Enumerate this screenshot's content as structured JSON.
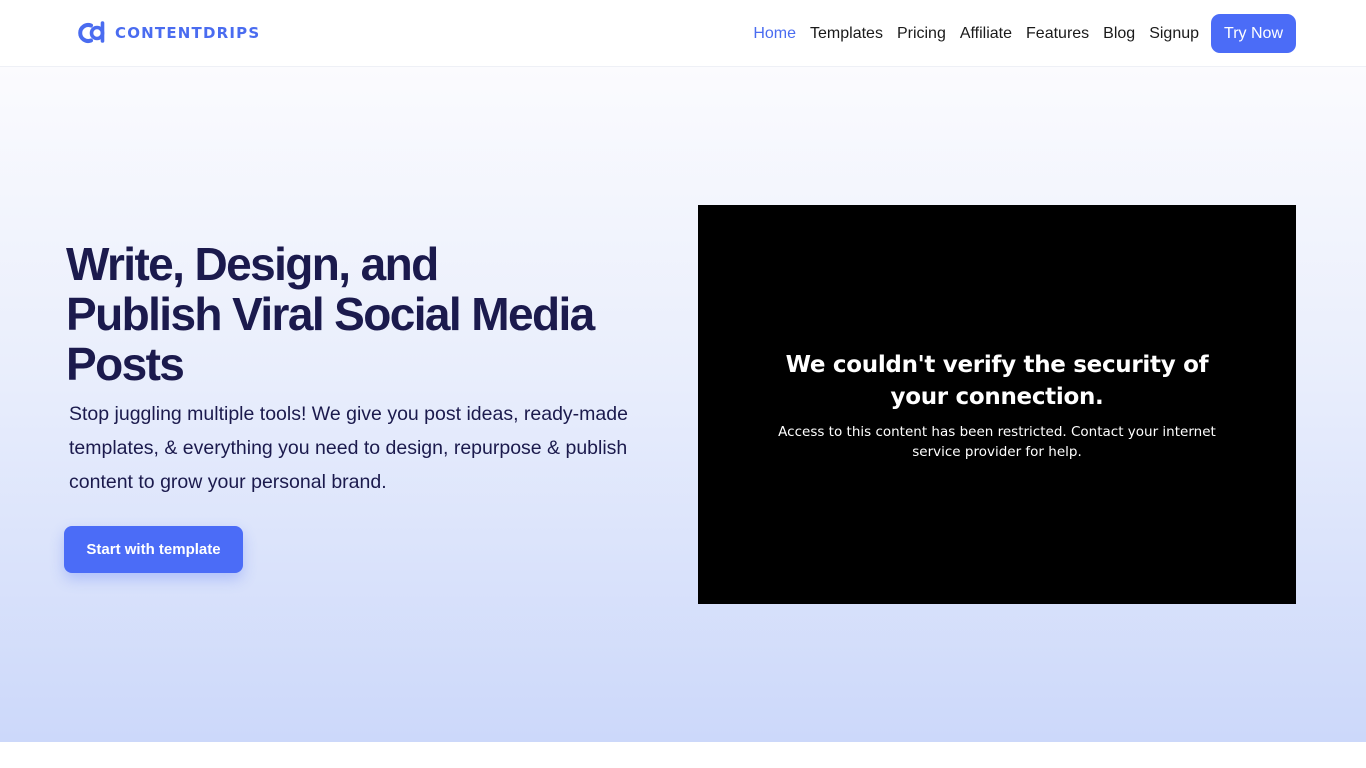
{
  "brand": {
    "name": "CONTENTDRIPS",
    "accent_color": "#4a6cf0",
    "logo_icon": "contentdrips-logo-icon"
  },
  "nav": {
    "items": [
      {
        "label": "Home",
        "active": true
      },
      {
        "label": "Templates",
        "active": false
      },
      {
        "label": "Pricing",
        "active": false
      },
      {
        "label": "Affiliate",
        "active": false
      },
      {
        "label": "Features",
        "active": false
      },
      {
        "label": "Blog",
        "active": false
      },
      {
        "label": "Signup",
        "active": false
      }
    ],
    "cta_label": "Try Now",
    "cta_color": "#4b6cf7"
  },
  "hero": {
    "title_lines": [
      "Write, Design, and",
      "Publish Viral Social Media",
      "Posts"
    ],
    "description": "Stop juggling multiple tools! We give you post ideas, ready-made templates, & everything you need to design, repurpose & publish content to grow your personal brand.",
    "button_label": "Start with template",
    "text_color": "#1b1a4d"
  },
  "embed": {
    "title": "We couldn't verify the security of your connection.",
    "message": "Access to this content has been restricted. Contact your internet service provider for help."
  }
}
